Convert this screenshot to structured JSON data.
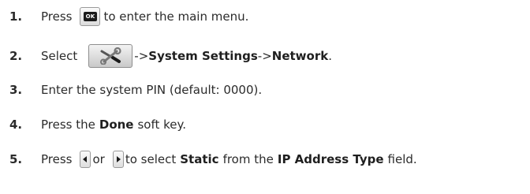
{
  "steps": [
    {
      "number": "1.",
      "text_before": "Press",
      "icon": "ok-key-icon",
      "icon_label": "OK",
      "text_after": "to enter the main menu."
    },
    {
      "number": "2.",
      "text_before": "Select",
      "icon": "settings-tools-icon",
      "arrow1": "->",
      "bold1": "System Settings",
      "arrow2": "->",
      "bold2": "Network",
      "end": "."
    },
    {
      "number": "3.",
      "text": "Enter the system PIN (default: 0000)."
    },
    {
      "number": "4.",
      "text_before": "Press the",
      "bold": "Done",
      "text_after": "soft key."
    },
    {
      "number": "5.",
      "text_before": "Press",
      "icon_left": "left-navigation-key-icon",
      "or": "or",
      "icon_right": "right-navigation-key-icon",
      "text_mid": "to select",
      "bold1": "Static",
      "text_mid2": "from the",
      "bold2": "IP Address Type",
      "text_end": "field."
    }
  ]
}
